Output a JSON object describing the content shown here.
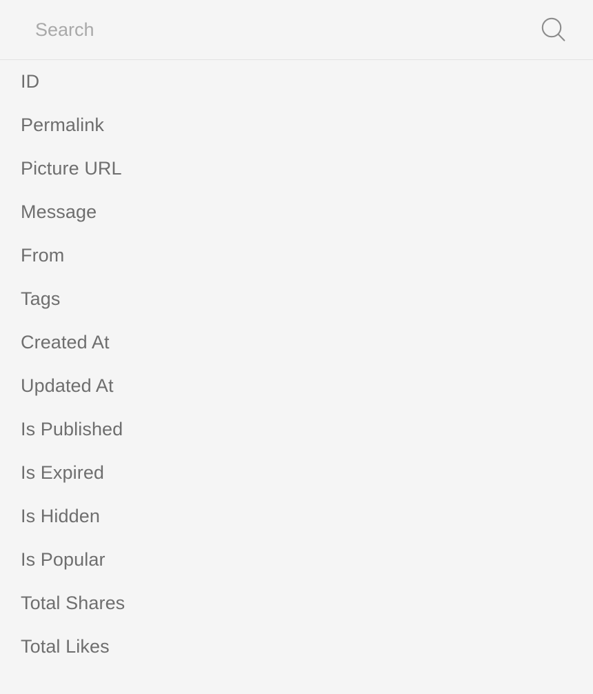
{
  "search": {
    "placeholder": "Search",
    "value": "",
    "icon": "search-icon"
  },
  "colors": {
    "background": "#f5f5f5",
    "divider": "#e3e3e3",
    "item_text": "#6e6e6e",
    "placeholder_text": "#a9a9a9",
    "icon": "#8c8c8c"
  },
  "fields": [
    {
      "label": "ID"
    },
    {
      "label": "Permalink"
    },
    {
      "label": "Picture URL"
    },
    {
      "label": "Message"
    },
    {
      "label": "From"
    },
    {
      "label": "Tags"
    },
    {
      "label": "Created At"
    },
    {
      "label": "Updated At"
    },
    {
      "label": "Is Published"
    },
    {
      "label": "Is Expired"
    },
    {
      "label": "Is Hidden"
    },
    {
      "label": "Is Popular"
    },
    {
      "label": "Total Shares"
    },
    {
      "label": "Total Likes"
    }
  ]
}
